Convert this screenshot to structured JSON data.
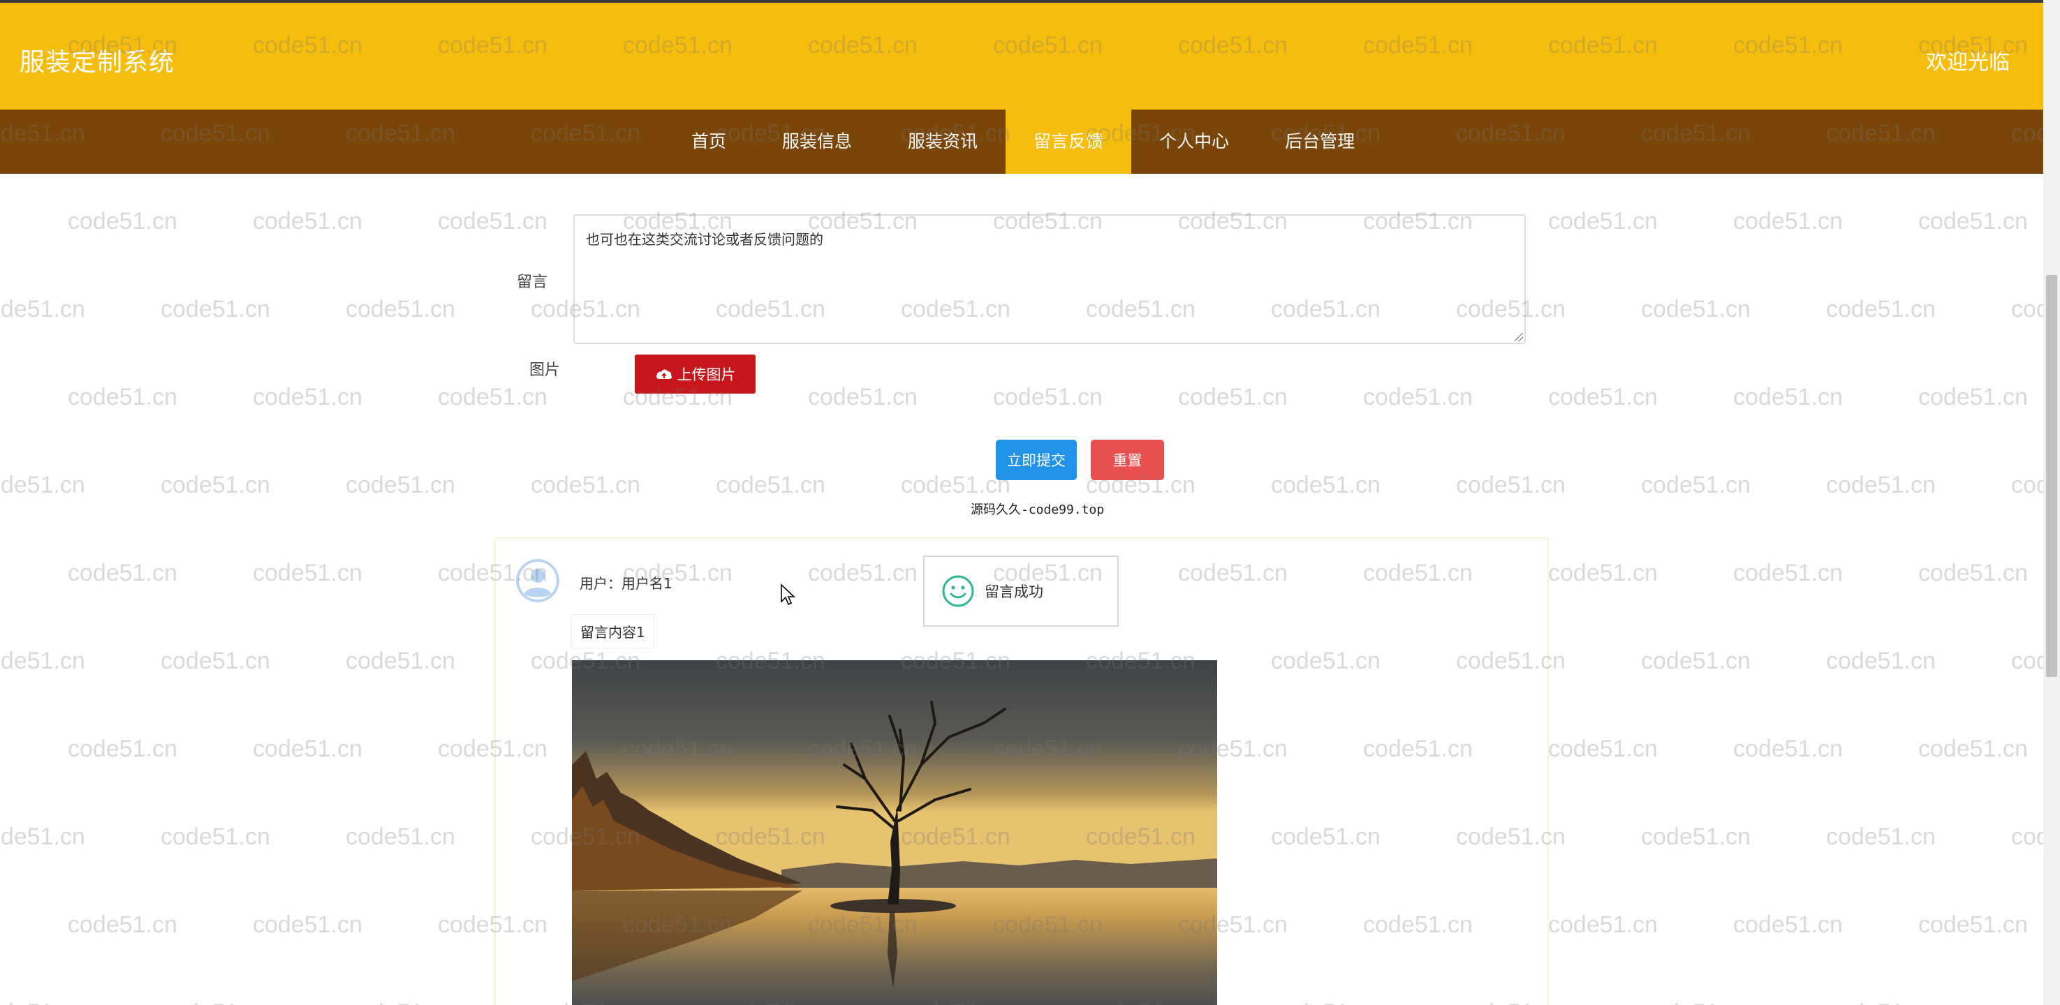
{
  "header": {
    "brand": "服装定制系统",
    "welcome": "欢迎光临"
  },
  "nav": {
    "items": [
      {
        "label": "首页",
        "active": false
      },
      {
        "label": "服装信息",
        "active": false
      },
      {
        "label": "服装资讯",
        "active": false
      },
      {
        "label": "留言反馈",
        "active": true
      },
      {
        "label": "个人中心",
        "active": false
      },
      {
        "label": "后台管理",
        "active": false
      }
    ]
  },
  "form": {
    "message_label": "留言",
    "message_value": "也可也在这类交流讨论或者反馈问题的",
    "image_label": "图片",
    "upload_label": "上传图片",
    "submit_label": "立即提交",
    "reset_label": "重置",
    "source_note": "源码久久-code99.top"
  },
  "comment": {
    "user_line": "用户：用户名1",
    "content": "留言内容1"
  },
  "toast": {
    "message": "留言成功",
    "icon": "smile-icon"
  },
  "watermark": {
    "text": "code51.cn"
  },
  "colors": {
    "header_bg": "#f6bd0d",
    "nav_bg": "#7a4508",
    "upload_btn": "#c8161d",
    "submit_btn": "#2092e8",
    "reset_btn": "#e8504f",
    "toast_icon": "#2fb98a"
  }
}
